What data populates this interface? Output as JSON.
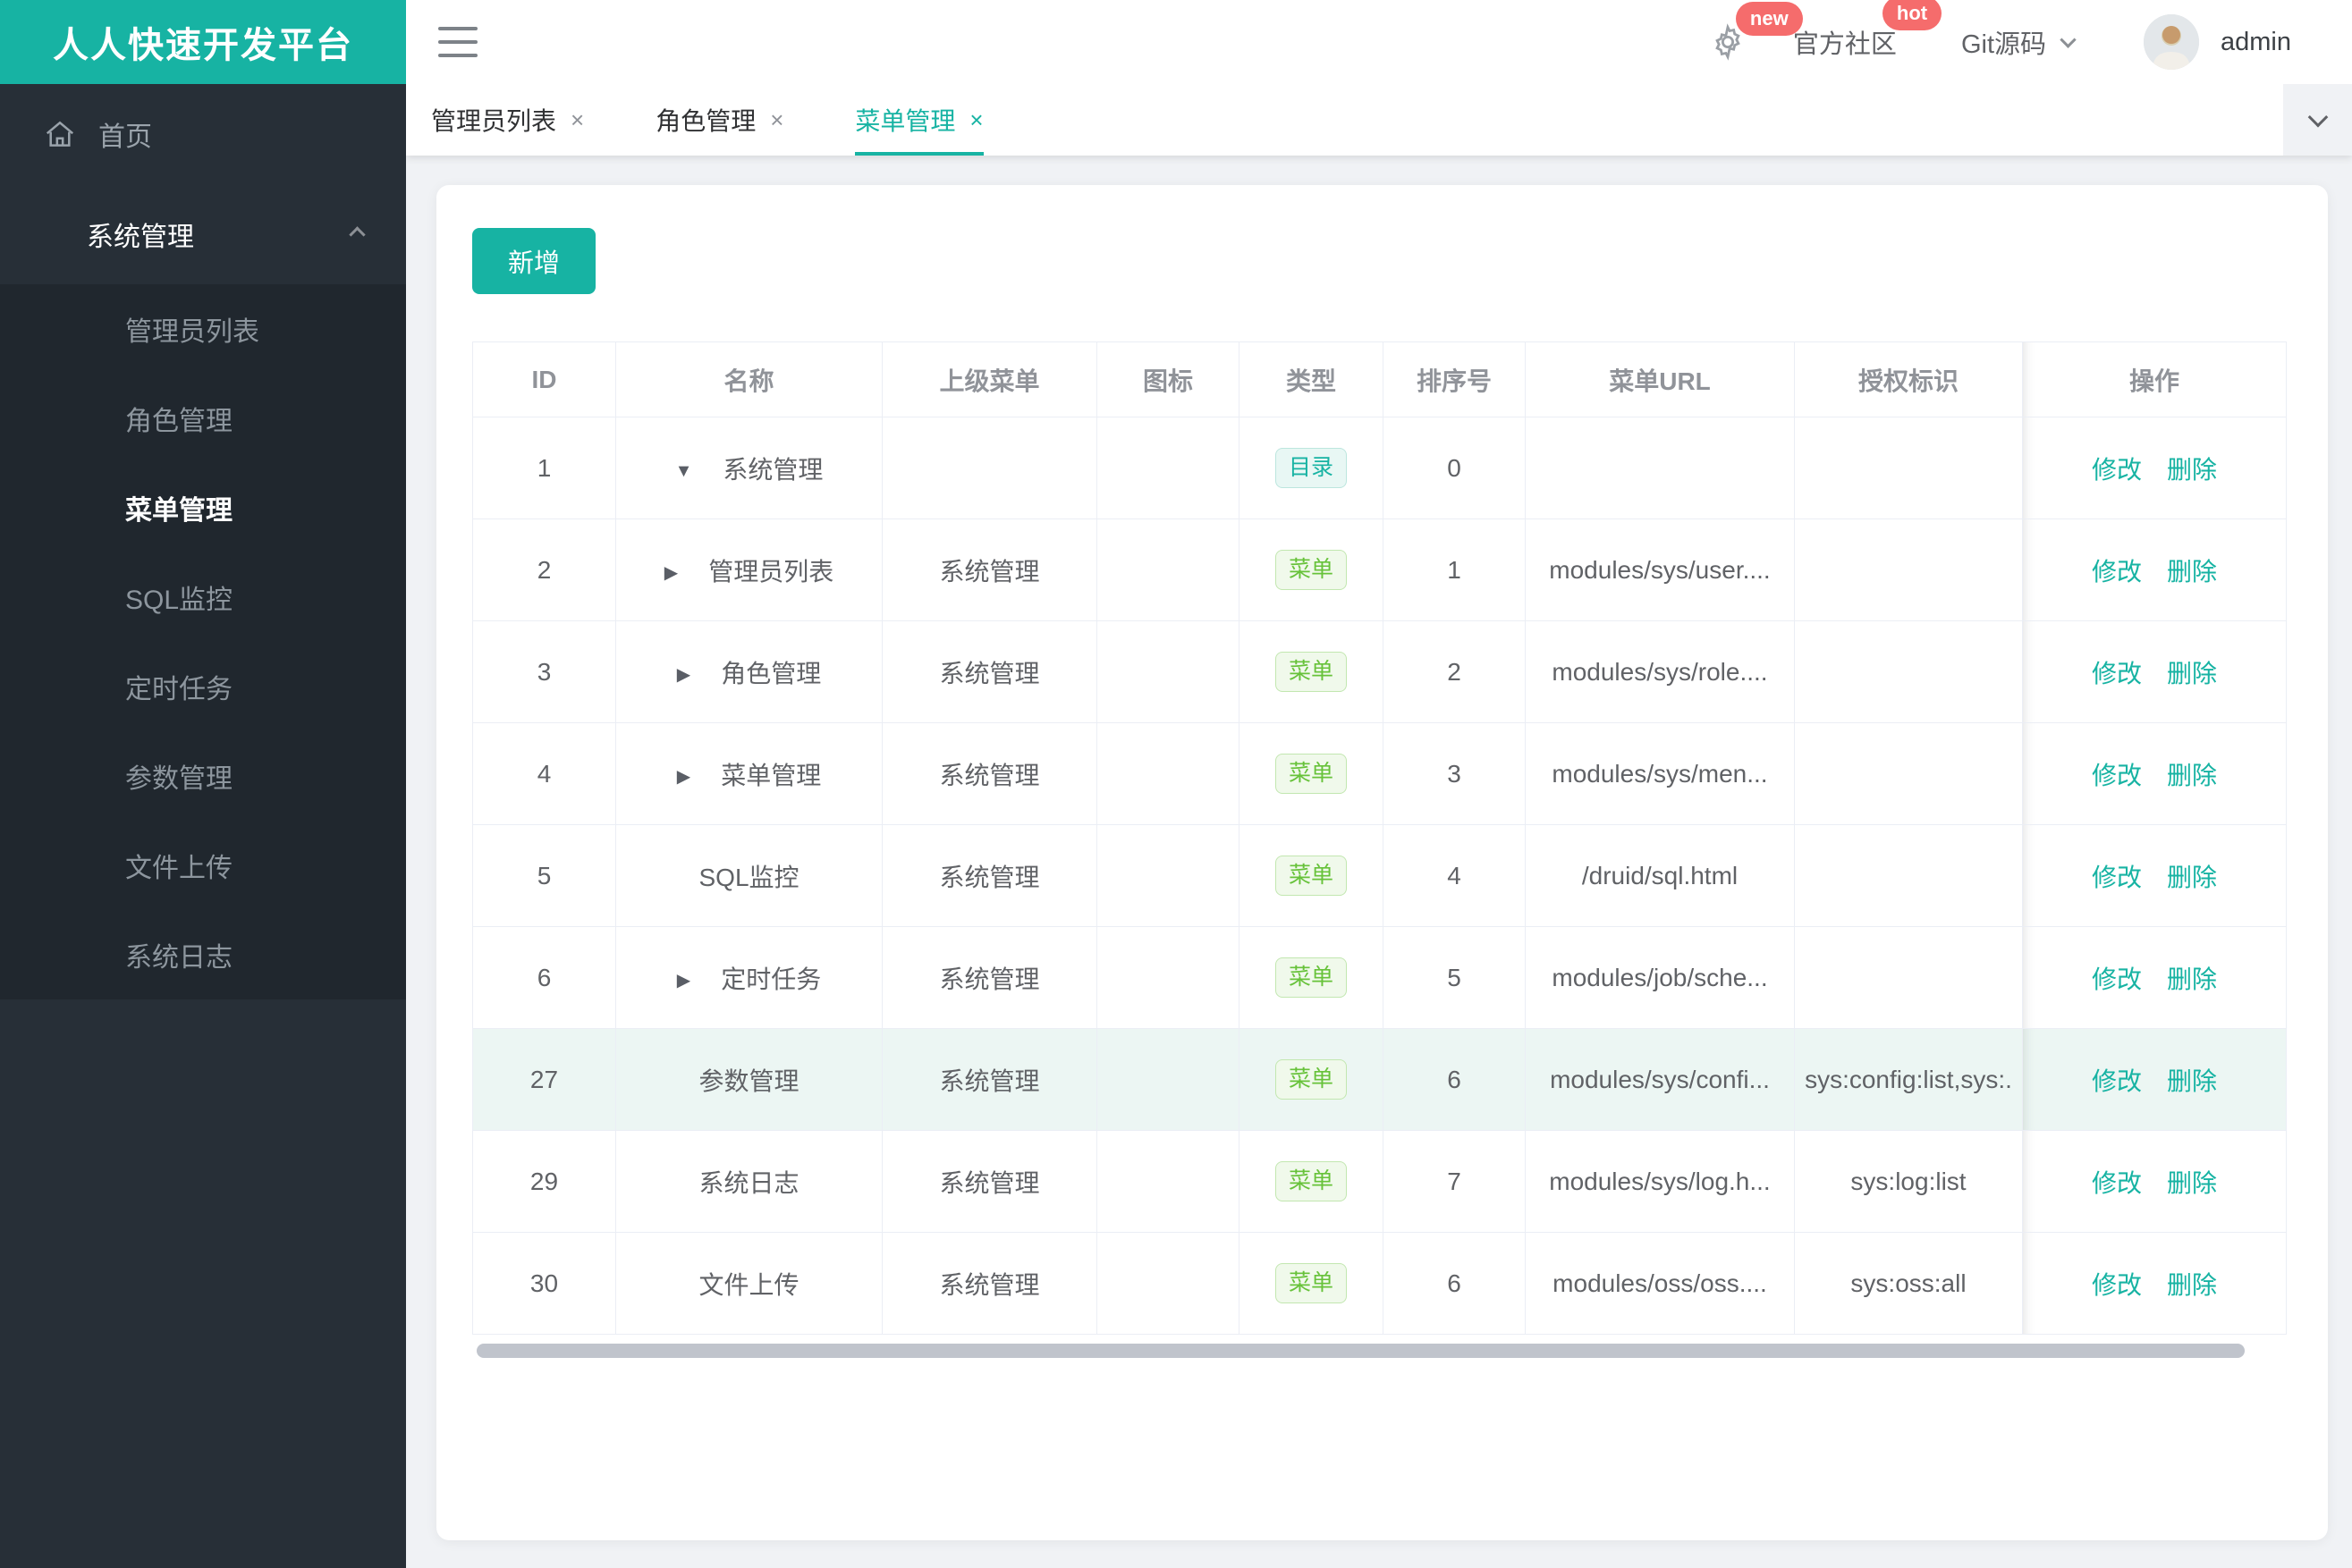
{
  "brand": {
    "title": "人人快速开发平台",
    "color": "#17b3a3"
  },
  "header": {
    "badge_new": "new",
    "badge_hot": "hot",
    "community_label": "官方社区",
    "git_label": "Git源码",
    "username": "admin",
    "badge_color": "#f56c6c"
  },
  "sidebar": {
    "home_label": "首页",
    "group_label": "系统管理",
    "items": [
      {
        "label": "管理员列表",
        "active": false
      },
      {
        "label": "角色管理",
        "active": false
      },
      {
        "label": "菜单管理",
        "active": true
      },
      {
        "label": "SQL监控",
        "active": false
      },
      {
        "label": "定时任务",
        "active": false
      },
      {
        "label": "参数管理",
        "active": false
      },
      {
        "label": "文件上传",
        "active": false
      },
      {
        "label": "系统日志",
        "active": false
      }
    ]
  },
  "tabs": {
    "close_glyph": "×",
    "items": [
      {
        "label": "管理员列表",
        "active": false
      },
      {
        "label": "角色管理",
        "active": false
      },
      {
        "label": "菜单管理",
        "active": true
      }
    ]
  },
  "toolbar": {
    "add_label": "新增"
  },
  "table": {
    "columns": [
      "ID",
      "名称",
      "上级菜单",
      "图标",
      "类型",
      "排序号",
      "菜单URL",
      "授权标识",
      "操作"
    ],
    "actions": {
      "edit": "修改",
      "delete": "删除"
    },
    "tag_colors": {
      "dir": {
        "text": "#17b3a3",
        "bg": "#e8f7f4"
      },
      "menu": {
        "text": "#67c23a",
        "bg": "#f0f9eb"
      }
    },
    "rows": [
      {
        "id": "1",
        "arrow": "▼",
        "name": "系统管理",
        "parent": "",
        "icon": "",
        "type": "目录",
        "type_kind": "dir",
        "order": "0",
        "url": "",
        "perm": "",
        "highlight": false
      },
      {
        "id": "2",
        "arrow": "▶",
        "name": "管理员列表",
        "parent": "系统管理",
        "icon": "",
        "type": "菜单",
        "type_kind": "menu",
        "order": "1",
        "url": "modules/sys/user....",
        "perm": "",
        "highlight": false
      },
      {
        "id": "3",
        "arrow": "▶",
        "name": "角色管理",
        "parent": "系统管理",
        "icon": "",
        "type": "菜单",
        "type_kind": "menu",
        "order": "2",
        "url": "modules/sys/role....",
        "perm": "",
        "highlight": false
      },
      {
        "id": "4",
        "arrow": "▶",
        "name": "菜单管理",
        "parent": "系统管理",
        "icon": "",
        "type": "菜单",
        "type_kind": "menu",
        "order": "3",
        "url": "modules/sys/men...",
        "perm": "",
        "highlight": false
      },
      {
        "id": "5",
        "arrow": "",
        "name": "SQL监控",
        "parent": "系统管理",
        "icon": "",
        "type": "菜单",
        "type_kind": "menu",
        "order": "4",
        "url": "/druid/sql.html",
        "perm": "",
        "highlight": false
      },
      {
        "id": "6",
        "arrow": "▶",
        "name": "定时任务",
        "parent": "系统管理",
        "icon": "",
        "type": "菜单",
        "type_kind": "menu",
        "order": "5",
        "url": "modules/job/sche...",
        "perm": "",
        "highlight": false
      },
      {
        "id": "27",
        "arrow": "",
        "name": "参数管理",
        "parent": "系统管理",
        "icon": "",
        "type": "菜单",
        "type_kind": "menu",
        "order": "6",
        "url": "modules/sys/confi...",
        "perm": "sys:config:list,sys:.",
        "highlight": true
      },
      {
        "id": "29",
        "arrow": "",
        "name": "系统日志",
        "parent": "系统管理",
        "icon": "",
        "type": "菜单",
        "type_kind": "menu",
        "order": "7",
        "url": "modules/sys/log.h...",
        "perm": "sys:log:list",
        "highlight": false
      },
      {
        "id": "30",
        "arrow": "",
        "name": "文件上传",
        "parent": "系统管理",
        "icon": "",
        "type": "菜单",
        "type_kind": "menu",
        "order": "6",
        "url": "modules/oss/oss....",
        "perm": "sys:oss:all",
        "highlight": false
      }
    ]
  }
}
